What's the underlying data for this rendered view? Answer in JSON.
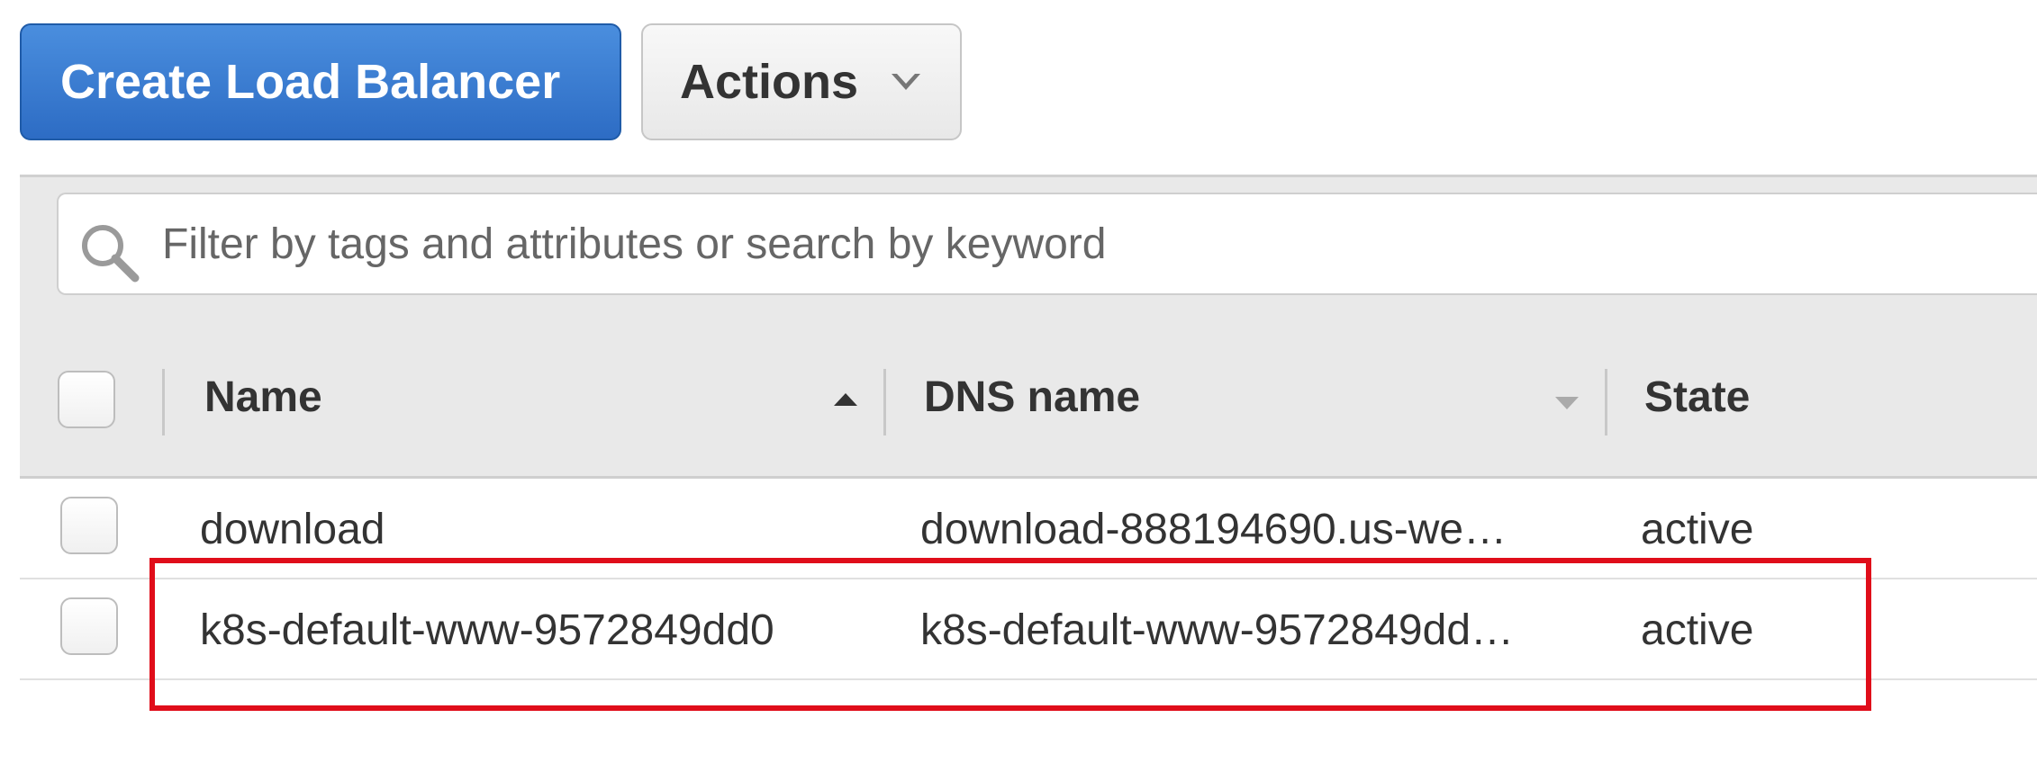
{
  "toolbar": {
    "create_label": "Create Load Balancer",
    "actions_label": "Actions"
  },
  "search": {
    "placeholder": "Filter by tags and attributes or search by keyword",
    "value": ""
  },
  "table": {
    "columns": [
      {
        "label": "Name",
        "sort": "ascending"
      },
      {
        "label": "DNS name",
        "sort": "none"
      },
      {
        "label": "State",
        "sort": "none"
      }
    ],
    "rows": [
      {
        "name": "download",
        "dns": "download-888194690.us-we…",
        "state": "active",
        "highlighted": false
      },
      {
        "name": "k8s-default-www-9572849dd0",
        "dns": "k8s-default-www-9572849dd…",
        "state": "active",
        "highlighted": true
      }
    ]
  },
  "colors": {
    "primary_button": "#2d6cc4",
    "highlight_border": "#e00d1a"
  },
  "icons": {
    "search": "search-icon",
    "actions_dropdown": "chevron-down-icon",
    "sort_ascending": "sort-ascending-icon",
    "sort_descending": "sort-descending-icon"
  }
}
